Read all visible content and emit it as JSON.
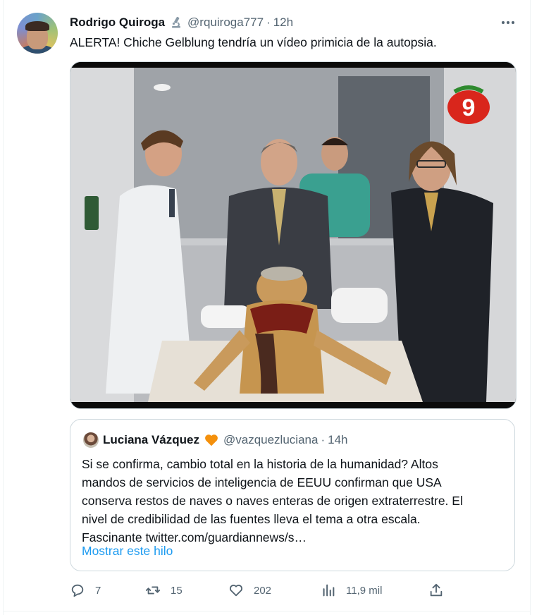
{
  "tweet": {
    "author_name": "Rodrigo Quiroga",
    "badge_icon": "microscope-icon",
    "handle": "@rquiroga777",
    "separator": "·",
    "time": "12h",
    "text": "ALERTA! Chiche Gelblung tendría un vídeo primicia de la autopsia.",
    "media": {
      "channel_logo_text": "9"
    }
  },
  "quote": {
    "author_name": "Luciana Vázquez",
    "badge_icon": "orange-heart-icon",
    "handle": "@vazquezluciana",
    "separator": "·",
    "time": "14h",
    "text_lines": [
      "Si se confirma, cambio total en la historia de la humanidad? Altos",
      "mandos de servicios de inteligencia de EEUU confirman que USA",
      "conserva restos de naves o naves enteras de origen extraterrestre. El",
      "nivel de credibilidad de las fuentes lleva el tema a otra escala.",
      "Fascinante twitter.com/guardiannews/s…"
    ],
    "show_thread_label": "Mostrar este hilo"
  },
  "actions": {
    "replies": "7",
    "retweets": "15",
    "likes": "202",
    "views": "11,9 mil"
  },
  "colors": {
    "text_primary": "#0f1419",
    "text_secondary": "#536471",
    "link": "#1d9bf0",
    "border": "#cfd9de",
    "heart_badge": "#f4900c"
  }
}
